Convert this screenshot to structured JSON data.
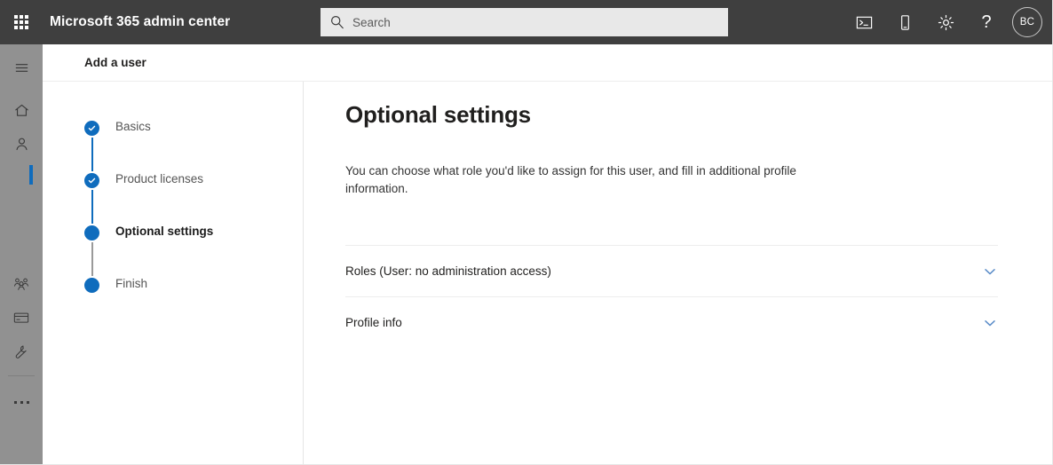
{
  "header": {
    "waffle_name": "app-launcher",
    "brand": "Microsoft 365 admin center",
    "search": {
      "placeholder": "Search",
      "value": ""
    },
    "icons": [
      {
        "name": "command-console-icon",
        "label": "Command console"
      },
      {
        "name": "mobile-device-icon",
        "label": "Mobile device"
      },
      {
        "name": "gear-icon",
        "label": "Settings"
      },
      {
        "name": "help-icon",
        "label": "?"
      }
    ],
    "avatar_initials": "BC"
  },
  "rail": {
    "items": [
      {
        "name": "hamburger-menu-icon",
        "label": "Show navigation"
      },
      {
        "name": "home-icon",
        "label": "Home"
      },
      {
        "name": "users-icon",
        "label": "Users"
      },
      {
        "name": "teams-groups-icon",
        "label": "Teams & groups"
      },
      {
        "name": "billing-icon",
        "label": "Billing"
      },
      {
        "name": "support-icon",
        "label": "Support"
      },
      {
        "name": "show-all-icon",
        "label": "Show all"
      }
    ]
  },
  "page": {
    "breadcrumb": "Add a user"
  },
  "wizard": {
    "steps": [
      {
        "label": "Basics",
        "state": "complete"
      },
      {
        "label": "Product licenses",
        "state": "complete"
      },
      {
        "label": "Optional settings",
        "state": "current"
      },
      {
        "label": "Finish",
        "state": "upcoming"
      }
    ]
  },
  "main": {
    "title": "Optional settings",
    "description": "You can choose what role you'd like to assign for this user, and fill in additional profile information.",
    "sections": [
      {
        "label": "Roles (User: no administration access)",
        "expanded": false
      },
      {
        "label": "Profile info",
        "expanded": false
      }
    ]
  },
  "colors": {
    "header_bg": "#3f3f3f",
    "rail_bg": "#919191",
    "accent_blue": "#0f6cbd",
    "chevron_blue": "#5a8cc8",
    "search_bg": "#e8e8e8"
  }
}
